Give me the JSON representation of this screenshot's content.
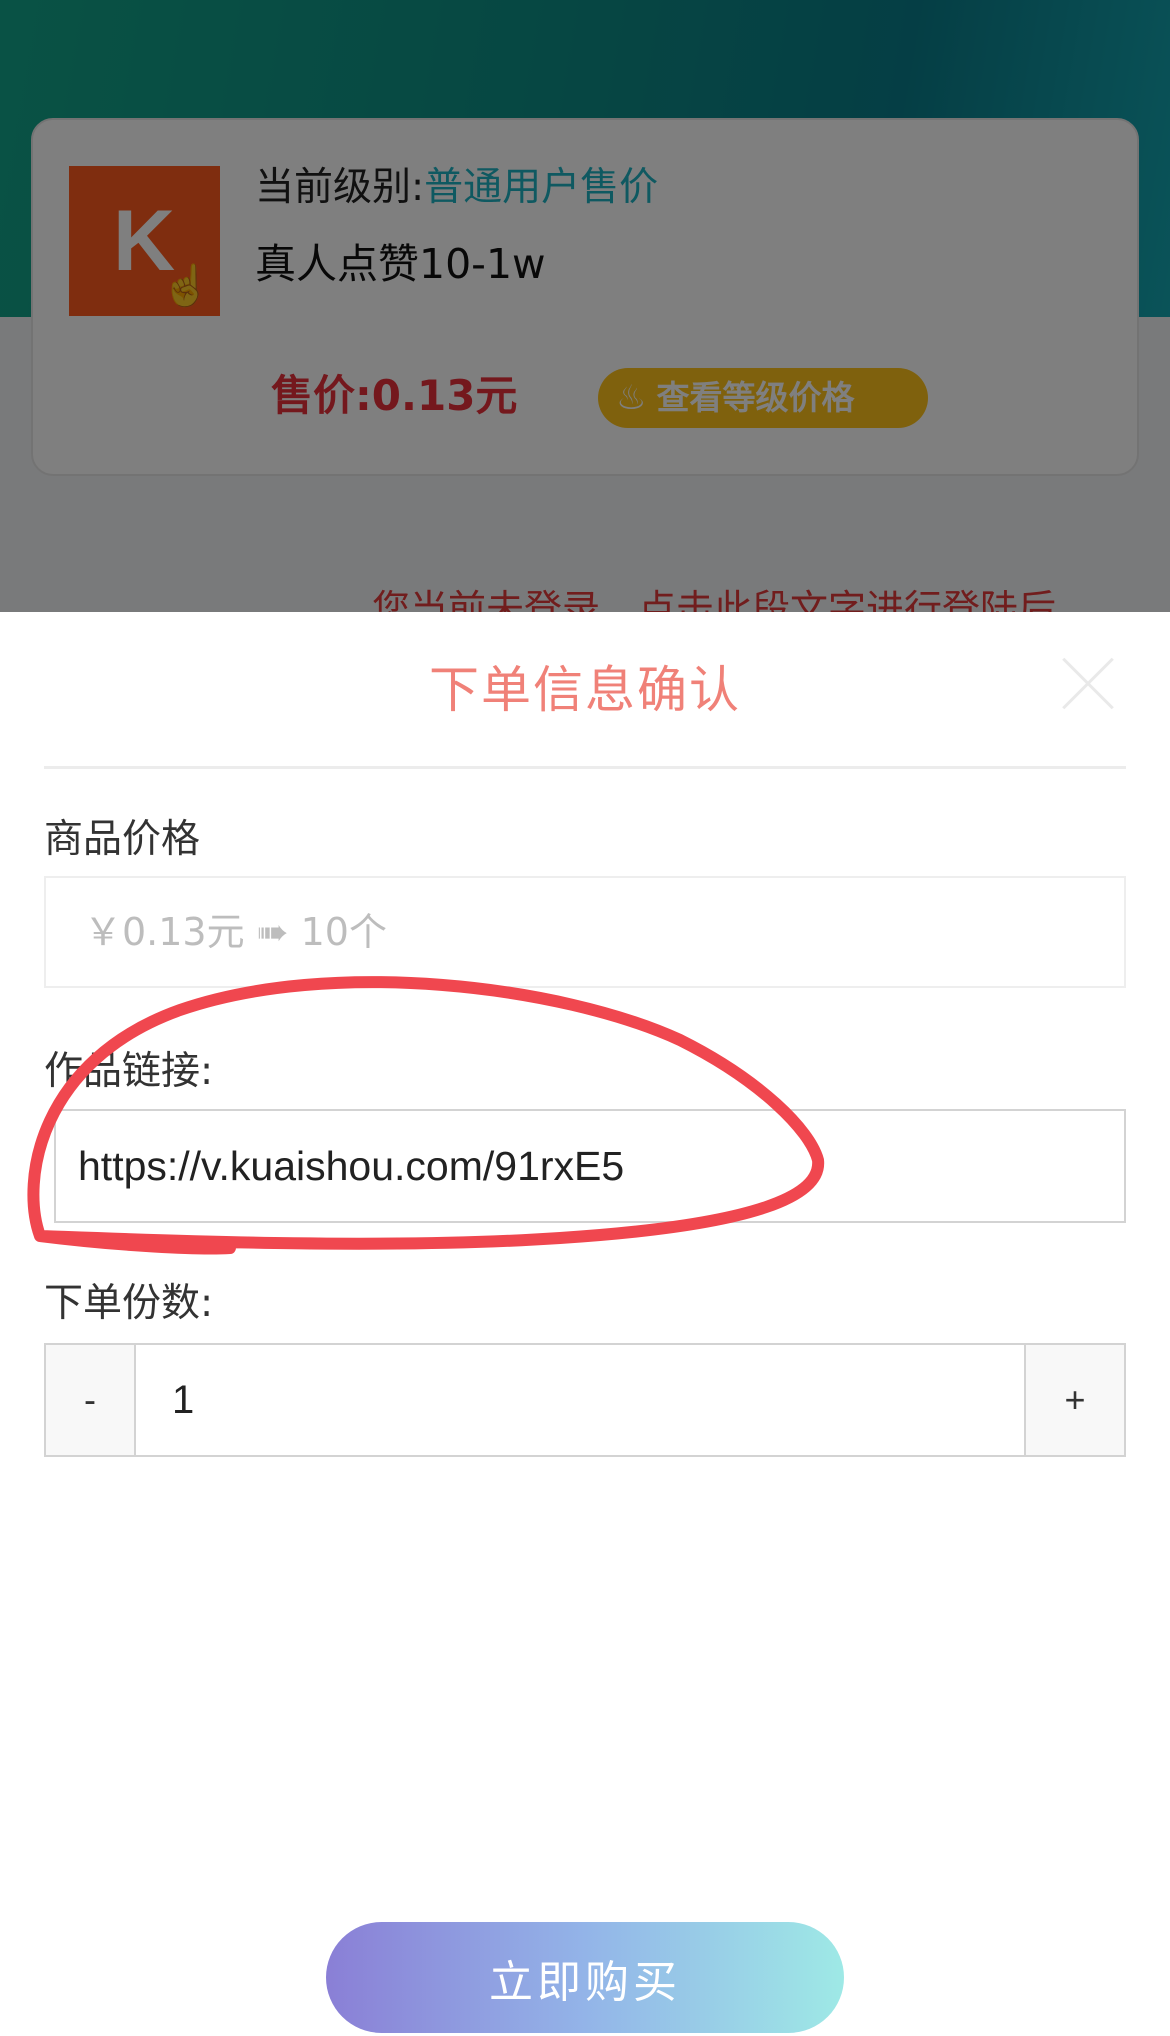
{
  "product": {
    "logo_letter": "K",
    "level_label": "当前级别:",
    "level_value": "普通用户售价",
    "name": "真人点赞10-1w",
    "price_text": "售价:0.13元",
    "level_price_button": "查看等级价格",
    "login_hint": "您当前未登录，点击此段文字进行登陆后"
  },
  "modal": {
    "title": "下单信息确认",
    "price_label": "商品价格",
    "price_value": "￥0.13元 ➠ 10个",
    "link_label": "作品链接:",
    "link_value": "https://v.kuaishou.com/91rxE5",
    "qty_label": "下单份数:",
    "qty_minus": "-",
    "qty_value": "1",
    "qty_plus": "+",
    "buy_button": "立即购买"
  },
  "colors": {
    "header_teal": "#13a58a",
    "title": "#f08178",
    "price_red": "#e8303a",
    "level_blue": "#1fb3c2",
    "badge_yellow": "#ffc21a",
    "annotation_red": "#f0474f"
  },
  "icons": [
    "hand-pointer-icon",
    "flame-icon",
    "close-icon"
  ]
}
